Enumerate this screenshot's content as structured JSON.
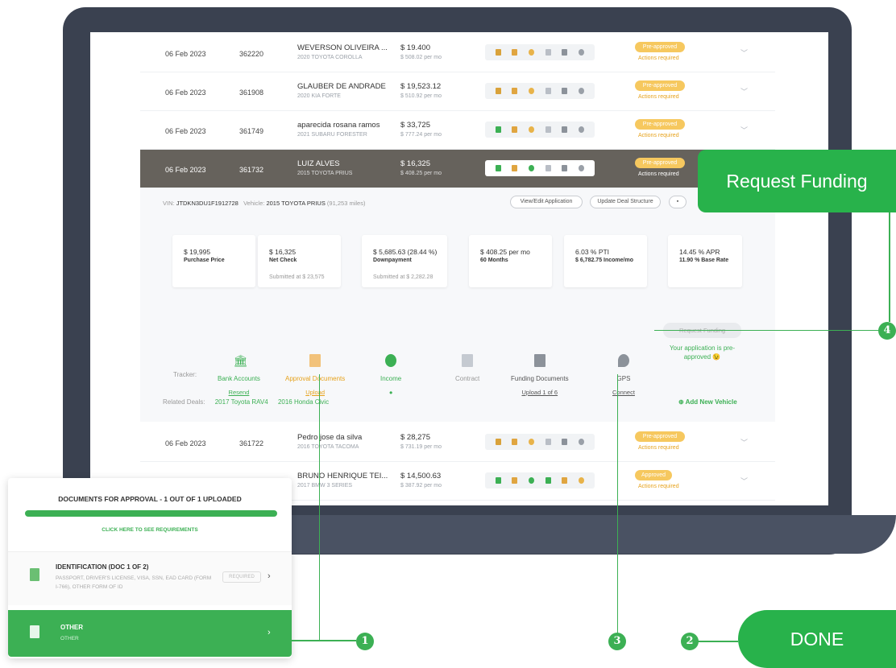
{
  "rows_top": [
    {
      "date": "06 Feb 2023",
      "id": "362220",
      "name": "WEVERSON OLIVEIRA ...",
      "car": "2020 TOYOTA COROLLA",
      "price": "$ 19.400",
      "monthly": "$ 508.02 per mo",
      "status": "Pre-approved",
      "action": "Actions required"
    },
    {
      "date": "06 Feb 2023",
      "id": "361908",
      "name": "GLAUBER DE ANDRADE",
      "car": "2020 KIA FORTE",
      "price": "$ 19,523.12",
      "monthly": "$ 510.92 per mo",
      "status": "Pre-approved",
      "action": "Actions required"
    },
    {
      "date": "06 Feb 2023",
      "id": "361749",
      "name": "aparecida rosana ramos",
      "car": "2021 SUBARU FORESTER",
      "price": "$ 33,725",
      "monthly": "$ 777.24 per mo",
      "status": "Pre-approved",
      "action": "Actions required"
    },
    {
      "date": "06 Feb 2023",
      "id": "361732",
      "name": "LUIZ ALVES",
      "car": "2015 TOYOTA PRIUS",
      "price": "$ 16,325",
      "monthly": "$ 408.25 per mo",
      "status": "Pre-approved",
      "action": "Actions required"
    }
  ],
  "detail": {
    "vin_label": "VIN:",
    "vin": "JTDKN3DU1F1912728",
    "vehicle_label": "Vehicle:",
    "vehicle": "2015 TOYOTA PRIUS",
    "miles": "(91,253 miles)",
    "view_edit": "View/Edit Application",
    "update_deal": "Update Deal Structure",
    "cards": [
      {
        "v": "$ 19,995",
        "l": "Purchase Price",
        "s": ""
      },
      {
        "v": "$ 16,325",
        "l": "Net Check",
        "s": "Submitted at $ 23,575"
      },
      {
        "v": "$ 5,685.63  (28.44 %)",
        "l": "Downpayment",
        "s": "Submitted at $ 2,282.28"
      },
      {
        "v": "$ 408.25 per mo",
        "l": "60 Months",
        "s": ""
      },
      {
        "v": "6.03 % PTI",
        "l": "$ 6,782.75 Income/mo",
        "s": ""
      },
      {
        "v": "14.45 % APR",
        "l": "11.90 % Base Rate",
        "s": ""
      }
    ],
    "tracker_label": "Tracker:",
    "tracker": [
      {
        "label": "Bank Accounts",
        "sub": "Resend"
      },
      {
        "label": "Approval Documents",
        "sub": "Upload"
      },
      {
        "label": "Income",
        "sub": ""
      },
      {
        "label": "Contract",
        "sub": ""
      },
      {
        "label": "Funding Documents",
        "sub": "Upload 1 of 6"
      },
      {
        "label": "GPS",
        "sub": "Connect"
      }
    ],
    "request_funding": "Request Funding",
    "preapproved_msg": "Your application is pre-approved 😉",
    "related_label": "Related Deals:",
    "related": [
      "2017 Toyota RAV4",
      "2016 Honda Civic"
    ],
    "add_vehicle": "Add New Vehicle"
  },
  "rows_bottom": [
    {
      "date": "06 Feb 2023",
      "id": "361722",
      "name": "Pedro jose da silva",
      "car": "2016 TOYOTA TACOMA",
      "price": "$ 28,275",
      "monthly": "$ 731.19 per mo",
      "status": "Pre-approved",
      "action": "Actions required"
    },
    {
      "date": "",
      "id": "",
      "name": "BRUNO HENRIQUE TEI...",
      "car": "2017 BMW 3 SERIES",
      "price": "$ 14,500.63",
      "monthly": "$ 387.92 per mo",
      "status": "Approved",
      "action": "Actions required"
    }
  ],
  "panel": {
    "title": "DOCUMENTS FOR APPROVAL - 1 OUT OF 1 UPLOADED",
    "progress_fraction": 1.0,
    "requirements": "CLICK HERE TO SEE REQUIREMENTS",
    "doc1_title": "IDENTIFICATION (DOC 1 OF 2)",
    "doc1_desc": "PASSPORT, DRIVER'S LICENSE, VISA, SSN, EAD CARD (FORM I-766), OTHER FORM OF ID",
    "doc1_required": "REQUIRED",
    "doc2_title": "OTHER",
    "doc2_desc": "OTHER"
  },
  "callouts": {
    "request_funding": "Request Funding",
    "done": "DONE",
    "n1": "1",
    "n2": "2",
    "n3": "3",
    "n4": "4"
  },
  "colors": {
    "green": "#3cb054",
    "callout_green": "#28b24b",
    "badge": "#f6c85f",
    "dark_row": "#66625c",
    "laptop": "#3a4150"
  }
}
